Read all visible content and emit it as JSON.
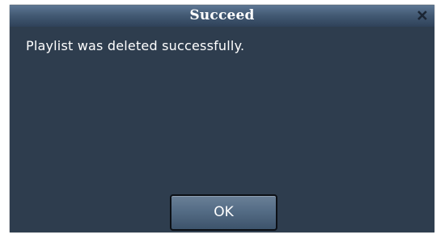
{
  "dialog": {
    "title": "Succeed",
    "message": "Playlist was deleted successfully.",
    "ok_label": "OK",
    "close_icon": "close-icon"
  },
  "colors": {
    "dialog_background": "#2e3d4e",
    "titlebar_top": "#5c7592",
    "titlebar_bottom": "#2f4259",
    "text": "#ffffff"
  }
}
